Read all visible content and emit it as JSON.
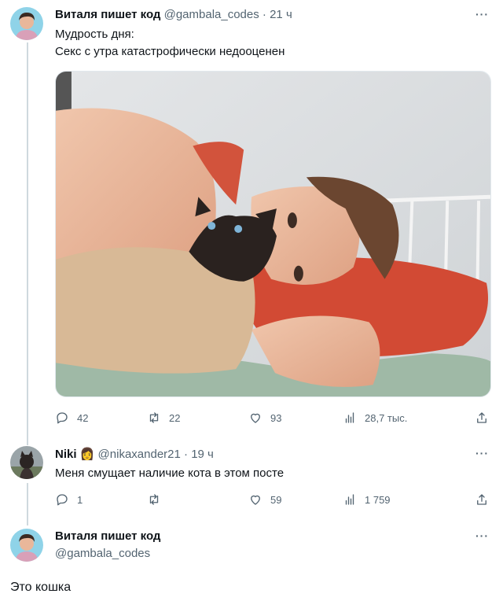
{
  "tweet": {
    "author_name": "Виталя пишет код",
    "author_handle": "@gambala_codes",
    "time": "21 ч",
    "more": "···",
    "lines": [
      "Мудрость дня:",
      "Секс с утра катастрофически недооценен"
    ],
    "stats": {
      "replies": "42",
      "retweets": "22",
      "likes": "93",
      "views": "28,7 тыс."
    }
  },
  "reply": {
    "author_name": "Niki",
    "author_emoji": "👩",
    "author_handle": "@nikaxander21",
    "time": "19 ч",
    "more": "···",
    "text": "Меня смущает наличие кота в этом посте",
    "stats": {
      "replies": "1",
      "retweets": "",
      "likes": "59",
      "views": "1 759"
    }
  },
  "answer": {
    "author_name": "Виталя пишет код",
    "author_handle": "@gambala_codes",
    "more": "···",
    "text": "Это кошка"
  },
  "colors": {
    "text": "#0f1419",
    "secondary": "#536471",
    "thread": "#cfd9de"
  },
  "icons": [
    "reply-icon",
    "retweet-icon",
    "like-icon",
    "views-icon",
    "share-icon",
    "more-icon"
  ]
}
